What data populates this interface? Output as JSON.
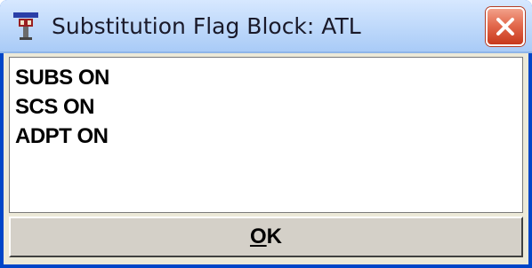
{
  "window": {
    "title": "Substitution Flag Block: ATL",
    "title_icon": "control-tower-icon",
    "close_icon": "close-icon"
  },
  "content": {
    "flags": [
      "SUBS ON",
      "SCS ON",
      "ADPT ON"
    ]
  },
  "buttons": {
    "ok_mnemonic": "O",
    "ok_rest": "K"
  },
  "colors": {
    "titlebar": "#c2dbfb",
    "frame_border": "#0046c8",
    "close_button": "#e36a4e",
    "button_face": "#d4d0c8",
    "content_bg": "#ffffff"
  }
}
